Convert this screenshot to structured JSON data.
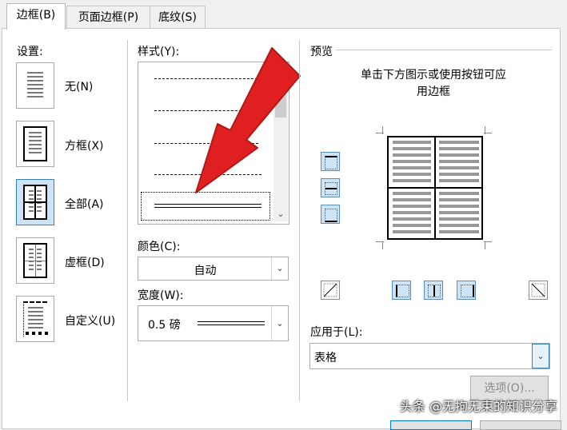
{
  "tabs": [
    {
      "label": "边框(B)",
      "active": true
    },
    {
      "label": "页面边框(P)",
      "active": false
    },
    {
      "label": "底纹(S)",
      "active": false
    }
  ],
  "settings": {
    "title": "设置:",
    "items": [
      {
        "label": "无(N)",
        "icon": "none-border-icon"
      },
      {
        "label": "方框(X)",
        "icon": "box-border-icon"
      },
      {
        "label": "全部(A)",
        "icon": "all-borders-icon",
        "selected": true
      },
      {
        "label": "虚框(D)",
        "icon": "grid-border-icon"
      },
      {
        "label": "自定义(U)",
        "icon": "custom-border-icon"
      }
    ]
  },
  "style": {
    "title": "样式(Y):",
    "options": [
      "dashed-fine",
      "dashed",
      "dash-dot",
      "dash-dot-dot",
      "double"
    ],
    "selected": "double"
  },
  "color": {
    "title": "颜色(C):",
    "value": "自动"
  },
  "width": {
    "title": "宽度(W):",
    "value": "0.5 磅"
  },
  "preview": {
    "title": "预览",
    "hint_line1": "单击下方图示或使用按钮可应",
    "hint_line2": "用边框"
  },
  "apply_to": {
    "title": "应用于(L):",
    "value": "表格"
  },
  "options_button": "选项(O)...",
  "watermark": "头条 @无拘无束的知识分享",
  "colors": {
    "annotation_arrow": "#e02020",
    "selection": "#cde4f7",
    "selection_border": "#3c7fb1"
  }
}
